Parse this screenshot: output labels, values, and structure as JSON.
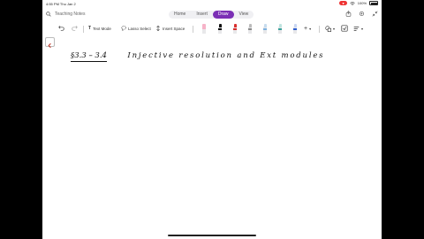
{
  "status_bar": {
    "time_date": "4:55 PM  Thu Jan 2",
    "battery": "100%",
    "rec_label": ""
  },
  "header": {
    "notebook_title": "Teaching Notes",
    "tabs": [
      {
        "label": "Home",
        "active": false
      },
      {
        "label": "Insert",
        "active": false
      },
      {
        "label": "Draw",
        "active": true
      },
      {
        "label": "View",
        "active": false
      }
    ]
  },
  "toolbar": {
    "text_mode": "Text Mode",
    "lasso_select": "Lasso Select",
    "insert_space": "Insert Space",
    "pens": [
      {
        "name": "pink-highlighter",
        "color": "#f6b3c8"
      },
      {
        "name": "black-pen",
        "color": "#111111"
      },
      {
        "name": "red-pen",
        "color": "#d9302f"
      },
      {
        "name": "gray-pen",
        "color": "#8c8c8c"
      },
      {
        "name": "light-blue-pen",
        "color": "#7fb2e0"
      },
      {
        "name": "teal-pen",
        "color": "#3aa29b"
      },
      {
        "name": "blue-pen",
        "color": "#2f5fd0"
      }
    ]
  },
  "page": {
    "section_ref": "§3.3 – 3.4",
    "heading": "Injective resolution and Ext modules"
  },
  "colors": {
    "accent": "#7b2fb5",
    "record": "#e33333"
  }
}
